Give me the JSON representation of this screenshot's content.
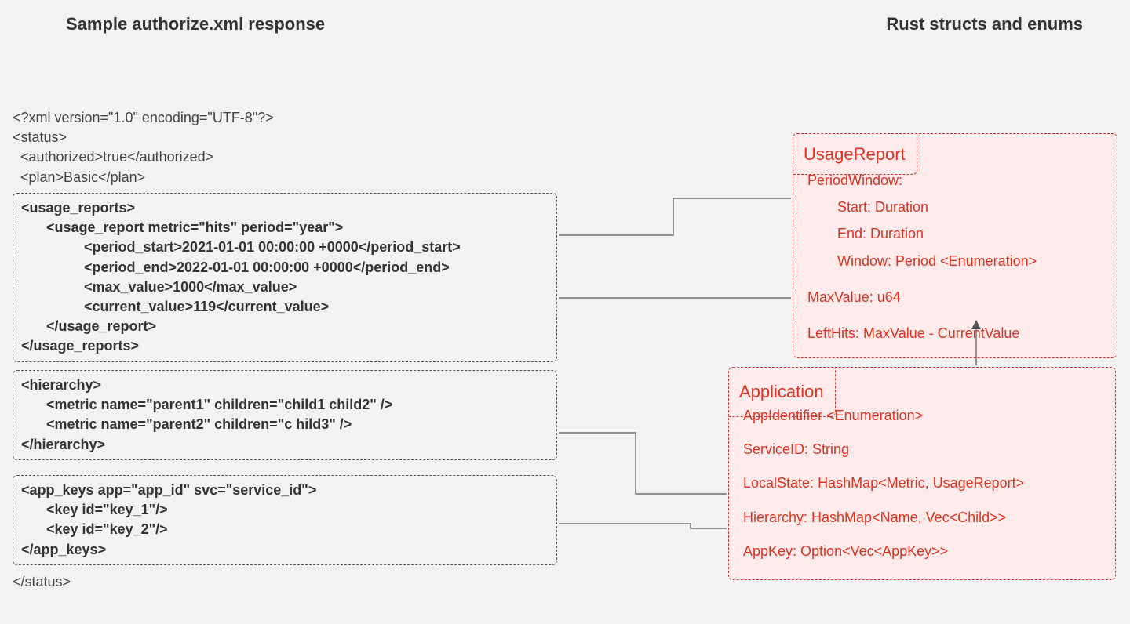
{
  "headings": {
    "left": "Sample authorize.xml response",
    "right": "Rust structs and enums"
  },
  "xml": {
    "declaration": "<?xml version=\"1.0\" encoding=\"UTF-8\"?>",
    "status_open": "<status>",
    "authorized": "  <authorized>true</authorized>",
    "plan": "  <plan>Basic</plan>",
    "status_close": "</status>",
    "usage_reports": {
      "open": "<usage_reports>",
      "report_open": "<usage_report metric=\"hits\" period=\"year\">",
      "period_start": "<period_start>2021-01-01 00:00:00 +0000</period_start>",
      "period_end": "<period_end>2022-01-01 00:00:00 +0000</period_end>",
      "max_value": "<max_value>1000</max_value>",
      "current_value": "<current_value>119</current_value>",
      "report_close": "</usage_report>",
      "close": "</usage_reports>"
    },
    "hierarchy": {
      "open": "<hierarchy>",
      "metric1": "<metric name=\"parent1\" children=\"child1 child2\" />",
      "metric2": "<metric name=\"parent2\" children=\"c hild3\" />",
      "close": "</hierarchy>"
    },
    "app_keys": {
      "open": "<app_keys app=\"app_id\" svc=\"service_id\">",
      "key1": "<key id=\"key_1\"/>",
      "key2": "<key id=\"key_2\"/>",
      "close": "</app_keys>"
    }
  },
  "structs": {
    "usage_report": {
      "title": "UsageReport",
      "period_window": "PeriodWindow:",
      "start": "Start: Duration",
      "end": "End:  Duration",
      "window": "Window: Period <Enumeration>",
      "max_value": "MaxValue: u64",
      "left_hits": "LeftHits: MaxValue - CurrentValue"
    },
    "application": {
      "title": "Application",
      "app_identifier": "AppIdentifier <Enumeration>",
      "service_id": "ServiceID: String",
      "local_state": "LocalState: HashMap<Metric, UsageReport>",
      "hierarchy": "Hierarchy: HashMap<Name, Vec<Child>>",
      "app_key": "AppKey: Option<Vec<AppKey>>"
    }
  }
}
